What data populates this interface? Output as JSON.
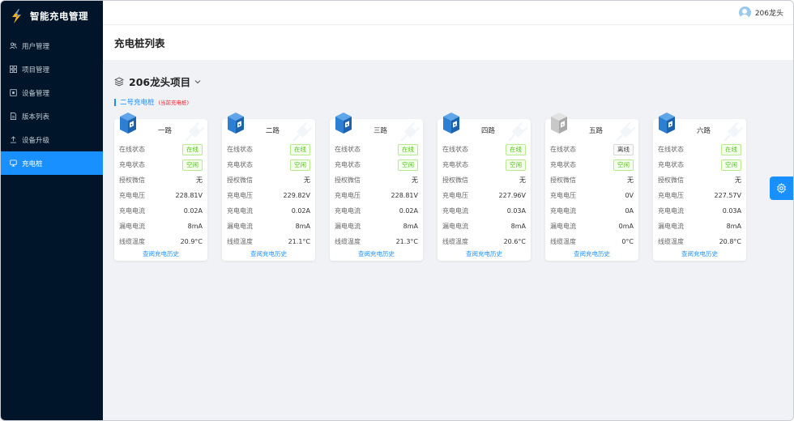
{
  "app": {
    "name": "智能充电管理"
  },
  "menu": [
    {
      "label": "用户管理",
      "icon": "user-group-icon"
    },
    {
      "label": "项目管理",
      "icon": "project-icon"
    },
    {
      "label": "设备管理",
      "icon": "device-icon"
    },
    {
      "label": "版本列表",
      "icon": "document-icon"
    },
    {
      "label": "设备升级",
      "icon": "upload-icon"
    },
    {
      "label": "充电桩",
      "icon": "charger-icon",
      "active": true
    }
  ],
  "header": {
    "username": "206龙头"
  },
  "page": {
    "title": "充电桩列表"
  },
  "project": {
    "name": "206龙头项目"
  },
  "section": {
    "name": "二号充电桩",
    "tag": "(当前充电桩)"
  },
  "labels": {
    "online": "在线状态",
    "charge": "充电状态",
    "auth": "授权微信",
    "voltage": "充电电压",
    "current": "充电电流",
    "leak": "漏电电流",
    "temp": "线缆温度",
    "history": "查阅充电历史"
  },
  "colors": {
    "accent": "#1890ff",
    "sidebar": "#001529",
    "online": "#52c41a",
    "cube_active": "#2d7fd3",
    "cube_offline": "#c8c8c8"
  },
  "ports": [
    {
      "name": "一路",
      "online": "在线",
      "charge": "空闲",
      "auth": "无",
      "voltage": "228.81V",
      "current": "0.02A",
      "leak": "8mA",
      "temp": "20.9°C",
      "is_online": true
    },
    {
      "name": "二路",
      "online": "在线",
      "charge": "空闲",
      "auth": "无",
      "voltage": "229.82V",
      "current": "0.02A",
      "leak": "8mA",
      "temp": "21.1°C",
      "is_online": true
    },
    {
      "name": "三路",
      "online": "在线",
      "charge": "空闲",
      "auth": "无",
      "voltage": "228.81V",
      "current": "0.02A",
      "leak": "8mA",
      "temp": "21.3°C",
      "is_online": true
    },
    {
      "name": "四路",
      "online": "在线",
      "charge": "空闲",
      "auth": "无",
      "voltage": "227.96V",
      "current": "0.03A",
      "leak": "8mA",
      "temp": "20.6°C",
      "is_online": true
    },
    {
      "name": "五路",
      "online": "离线",
      "charge": "空闲",
      "auth": "无",
      "voltage": "0V",
      "current": "0A",
      "leak": "0mA",
      "temp": "0°C",
      "is_online": false
    },
    {
      "name": "六路",
      "online": "在线",
      "charge": "空闲",
      "auth": "无",
      "voltage": "227.57V",
      "current": "0.03A",
      "leak": "8mA",
      "temp": "20.8°C",
      "is_online": true
    }
  ]
}
